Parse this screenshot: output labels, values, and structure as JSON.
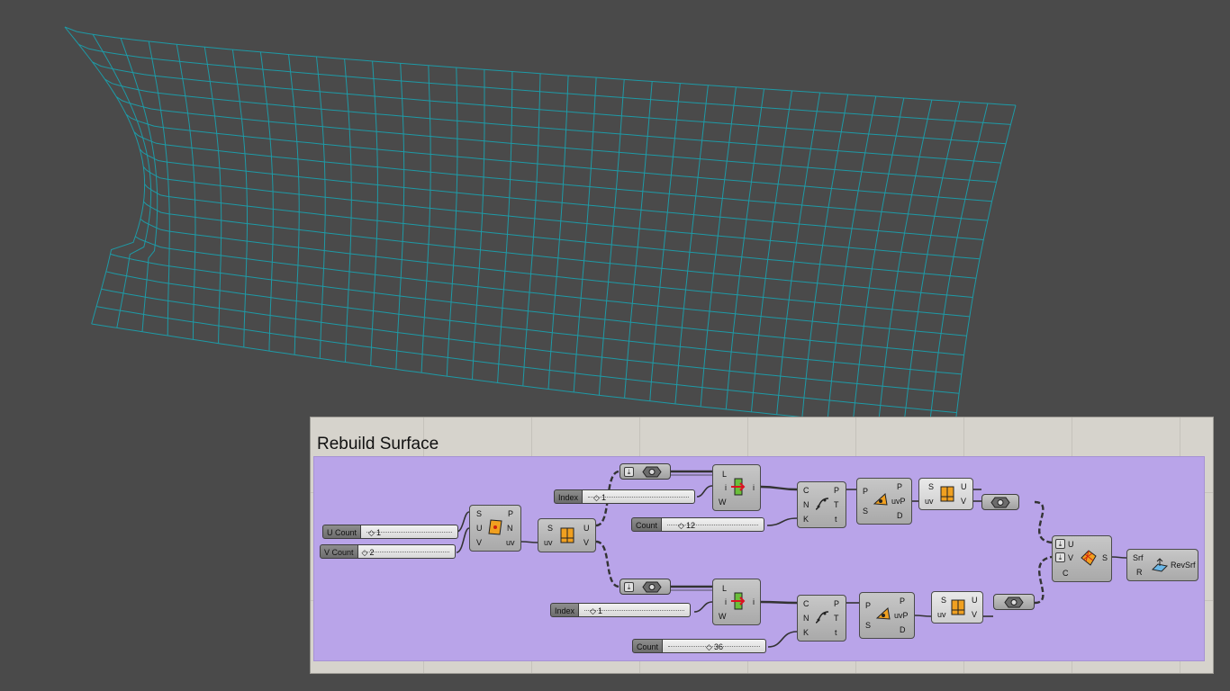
{
  "group": {
    "title": "Rebuild Surface"
  },
  "sliders": [
    {
      "label": "U Count",
      "value": "1"
    },
    {
      "label": "V Count",
      "value": "2"
    },
    {
      "label": "Index",
      "value": "1"
    },
    {
      "label": "Count",
      "value": "12"
    },
    {
      "label": "Index",
      "value": "1"
    },
    {
      "label": "Count",
      "value": "36"
    }
  ],
  "components": {
    "evaluate_surface": {
      "inputs": [
        "S",
        "U",
        "V"
      ],
      "outputs": [
        "P",
        "N",
        "uv"
      ]
    },
    "deconstruct_point_top": {
      "inputs": [
        "S",
        "uv"
      ],
      "outputs": [
        "U",
        "V"
      ]
    },
    "insert_top": {
      "inputs": [
        "L",
        "i",
        "W"
      ],
      "outputs": [
        "i"
      ]
    },
    "insert_bottom": {
      "inputs": [
        "L",
        "i",
        "W"
      ],
      "outputs": [
        "i"
      ]
    },
    "curve_top": {
      "inputs": [
        "C",
        "N",
        "K"
      ],
      "outputs": [
        "P",
        "T",
        "t"
      ]
    },
    "curve_bottom": {
      "inputs": [
        "C",
        "N",
        "K"
      ],
      "outputs": [
        "P",
        "T",
        "t"
      ]
    },
    "surface_closest_top": {
      "inputs": [
        "P",
        "S"
      ],
      "outputs": [
        "P",
        "uvP",
        "D"
      ]
    },
    "surface_closest_bottom": {
      "inputs": [
        "P",
        "S"
      ],
      "outputs": [
        "P",
        "uvP",
        "D"
      ]
    },
    "deconstruct_top": {
      "inputs": [
        "S",
        "uv"
      ],
      "outputs": [
        "U",
        "V"
      ]
    },
    "deconstruct_bottom": {
      "inputs": [
        "S",
        "uv"
      ],
      "outputs": [
        "U",
        "V"
      ]
    },
    "surface_from_uv": {
      "inputs": [
        "U",
        "V",
        "C"
      ],
      "outputs": [
        "S"
      ]
    },
    "revsrf": {
      "inputs": [
        "Srf",
        "R"
      ],
      "label": "RevSrf"
    }
  },
  "colors": {
    "background": "#4a4a4a",
    "mesh": "#1e9aa6",
    "canvas": "#d6d3cc",
    "group": "#b9a4e9"
  }
}
